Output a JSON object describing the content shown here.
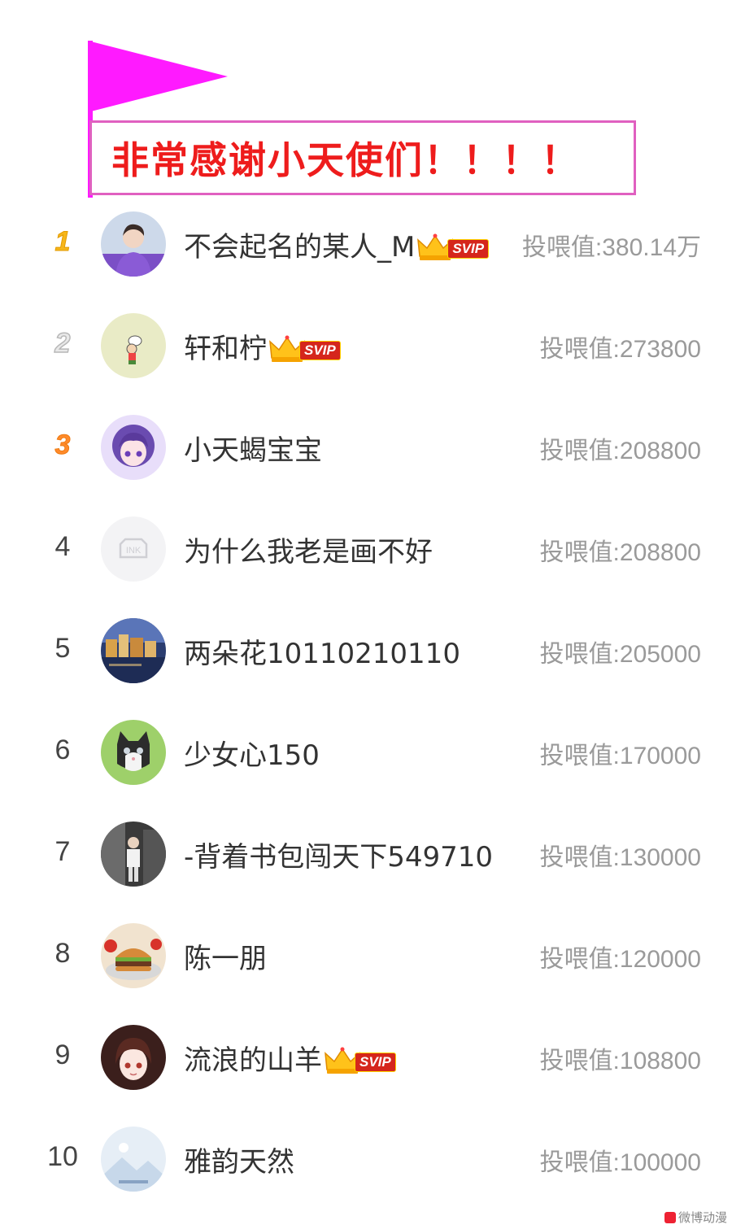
{
  "banner": {
    "text": "非常感谢小天使们！！！！",
    "flag_color": "#ff1aff"
  },
  "score_label": "投喂值",
  "rows": [
    {
      "rank": "1",
      "name": "不会起名的某人_M",
      "svip": true,
      "score": "投喂值:380.14万",
      "avatar": "avatar-person-purple-hoodie"
    },
    {
      "rank": "2",
      "name": "轩和柠",
      "svip": true,
      "score": "投喂值:273800",
      "avatar": "avatar-cartoon-chef"
    },
    {
      "rank": "3",
      "name": "小天蝎宝宝",
      "svip": false,
      "score": "投喂值:208800",
      "avatar": "avatar-anime-purple-hair"
    },
    {
      "rank": "4",
      "name": "为什么我老是画不好",
      "svip": false,
      "score": "投喂值:208800",
      "avatar": "avatar-ink-default"
    },
    {
      "rank": "5",
      "name": "两朵花10110210110",
      "svip": false,
      "score": "投喂值:205000",
      "avatar": "avatar-city-night"
    },
    {
      "rank": "6",
      "name": "少女心150",
      "svip": false,
      "score": "投喂值:170000",
      "avatar": "avatar-kitten"
    },
    {
      "rank": "7",
      "name": "-背着书包闯天下549710",
      "svip": false,
      "score": "投喂值:130000",
      "avatar": "avatar-person-photo"
    },
    {
      "rank": "8",
      "name": "陈一朋",
      "svip": false,
      "score": "投喂值:120000",
      "avatar": "avatar-burger"
    },
    {
      "rank": "9",
      "name": "流浪的山羊",
      "svip": true,
      "score": "投喂值:108800",
      "avatar": "avatar-anime-girl"
    },
    {
      "rank": "10",
      "name": "雅韵天然",
      "svip": false,
      "score": "投喂值:100000",
      "avatar": "avatar-landscape-default"
    }
  ],
  "svip_label": "SVIP",
  "watermark": "微博动漫"
}
